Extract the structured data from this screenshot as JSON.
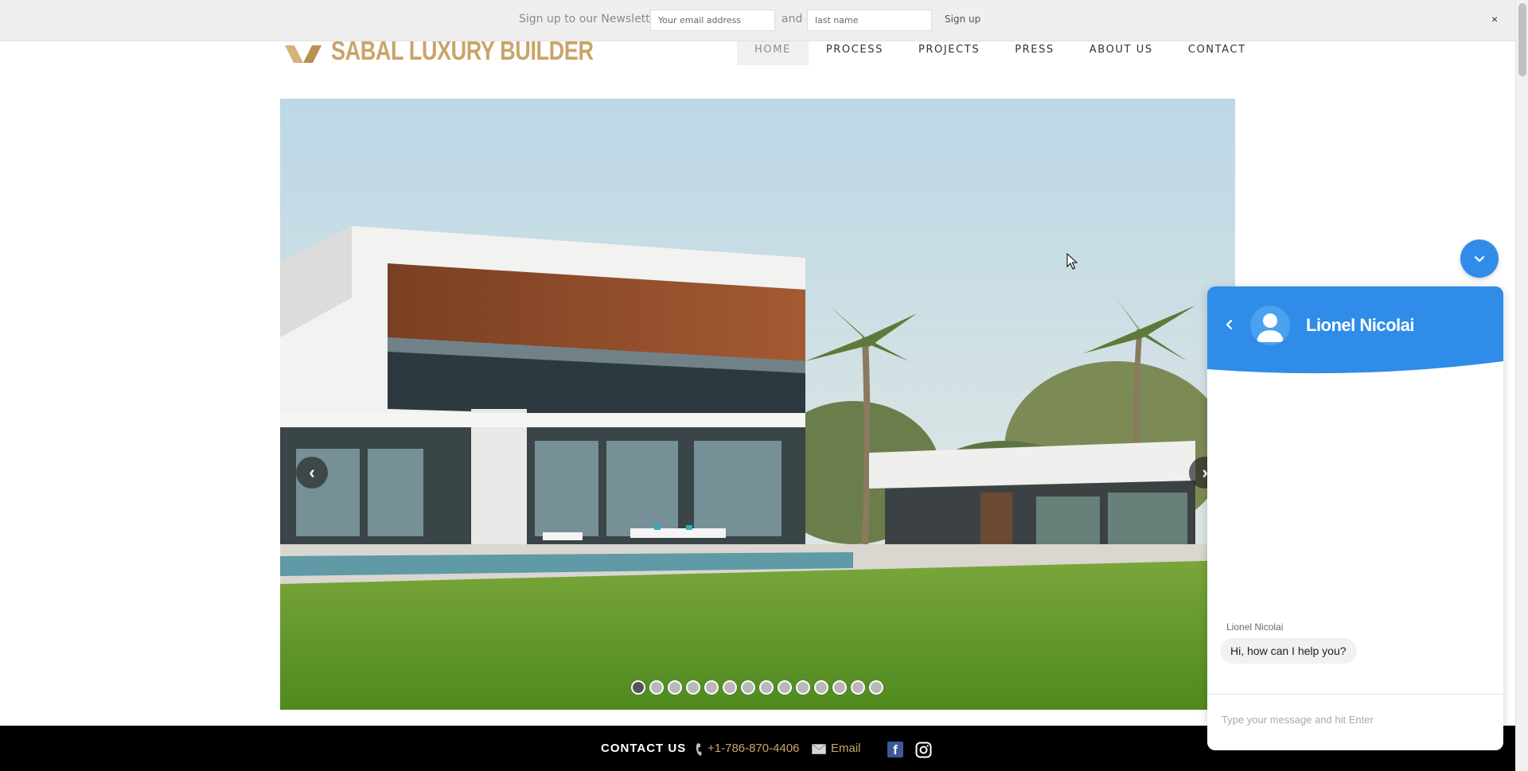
{
  "newsletter": {
    "label": "Sign up to our Newsletter:",
    "email_placeholder": "Your email address",
    "and_text": "and",
    "name_placeholder": "last name",
    "signup_label": "Sign up",
    "close_label": "×"
  },
  "header": {
    "logo_text": "SABAL LUXURY BUILDER",
    "nav": [
      {
        "label": "HOME",
        "active": true
      },
      {
        "label": "PROCESS"
      },
      {
        "label": "PROJECTS"
      },
      {
        "label": "PRESS"
      },
      {
        "label": "ABOUT US"
      },
      {
        "label": "CONTACT"
      }
    ]
  },
  "slider": {
    "prev_label": "‹",
    "next_label": "›",
    "total_slides": 14,
    "current_slide": 1
  },
  "contact_bar": {
    "title": "CONTACT US",
    "phone": "+1-786-870-4406",
    "email_label": "Email",
    "facebook_label": "f"
  },
  "chat": {
    "agent_name": "Lionel Nicolai",
    "sender_label": "Lionel Nicolai",
    "message": "Hi, how can I help you?",
    "input_placeholder": "Type your message and hit Enter"
  },
  "colors": {
    "accent_gold": "#c9a469",
    "chat_blue": "#2f8ce8",
    "contact_bar_bg": "#000000"
  }
}
